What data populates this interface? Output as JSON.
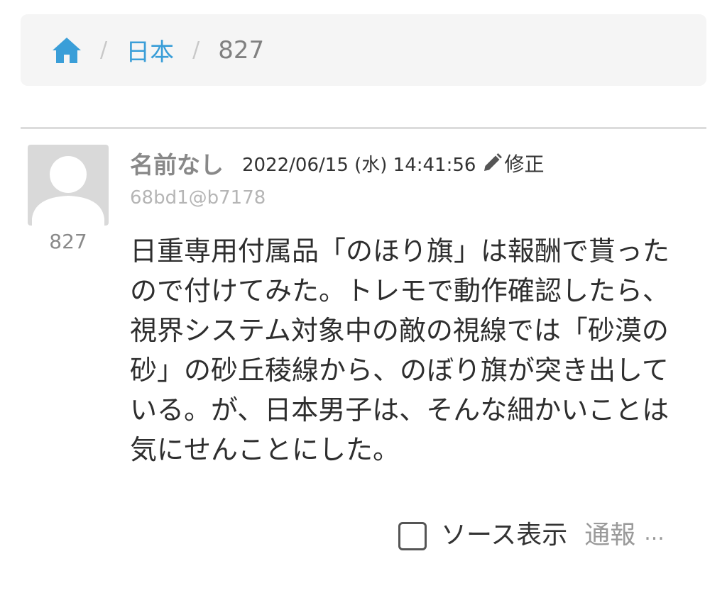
{
  "breadcrumb": {
    "home_icon": "home-icon",
    "separator": "/",
    "items": [
      "日本",
      "827"
    ]
  },
  "post": {
    "number": "827",
    "author": "名前なし",
    "date": "2022/06/15 (水) 14:41:56",
    "edit_label": "修正",
    "user_id": "68bd1@b7178",
    "body_lines": [
      "日重専用付属品「のほり旗」は報酬で貰った",
      "ので付けてみた。トレモで動作確認したら、",
      "視界システム対象中の敵の視線では「砂漠の",
      "砂」の砂丘稜線から、のぼり旗が突き出して",
      "いる。が、日本男子は、そんな細かいことは",
      "気にせんことにした。"
    ]
  },
  "footer": {
    "source_label": "ソース表示",
    "report_label": "通報",
    "more": "..."
  },
  "colors": {
    "link": "#3a9ed8",
    "breadcrumb_bg": "#f5f5f5",
    "avatar_bg": "#d9d9d9"
  }
}
